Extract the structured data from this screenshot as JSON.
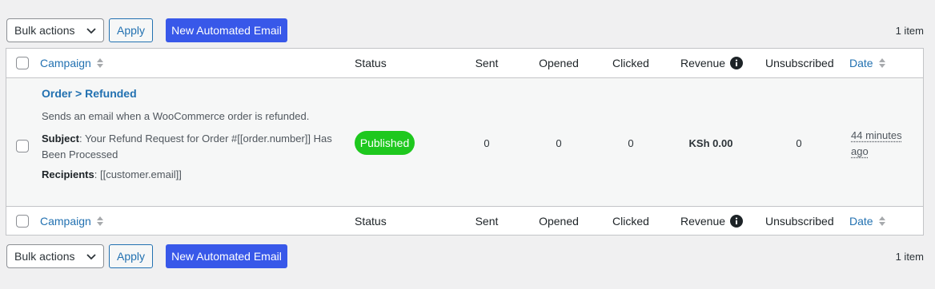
{
  "toolbar_top": {
    "bulk_actions": "Bulk actions",
    "apply": "Apply",
    "new_email": "New Automated Email",
    "count": "1 item"
  },
  "toolbar_bottom": {
    "bulk_actions": "Bulk actions",
    "apply": "Apply",
    "new_email": "New Automated Email",
    "count": "1 item"
  },
  "columns": {
    "campaign": "Campaign",
    "status": "Status",
    "sent": "Sent",
    "opened": "Opened",
    "clicked": "Clicked",
    "revenue": "Revenue",
    "unsubscribed": "Unsubscribed",
    "date": "Date"
  },
  "row": {
    "title": "Order > Refunded",
    "description": "Sends an email when a WooCommerce order is refunded.",
    "subject_label": "Subject",
    "subject_value": ": Your Refund Request for Order #[[order.number]] Has Been Processed",
    "recipients_label": "Recipients",
    "recipients_value": ": [[customer.email]]",
    "status": "Published",
    "sent": "0",
    "opened": "0",
    "clicked": "0",
    "revenue": "KSh 0.00",
    "unsubscribed": "0",
    "date": "44 minutes ago"
  },
  "colors": {
    "link": "#2271b1",
    "primary_button": "#3858e9",
    "published_badge": "#1ec81e"
  },
  "icons": [
    "chevron-down-icon",
    "sort-arrows-icon",
    "info-icon"
  ]
}
